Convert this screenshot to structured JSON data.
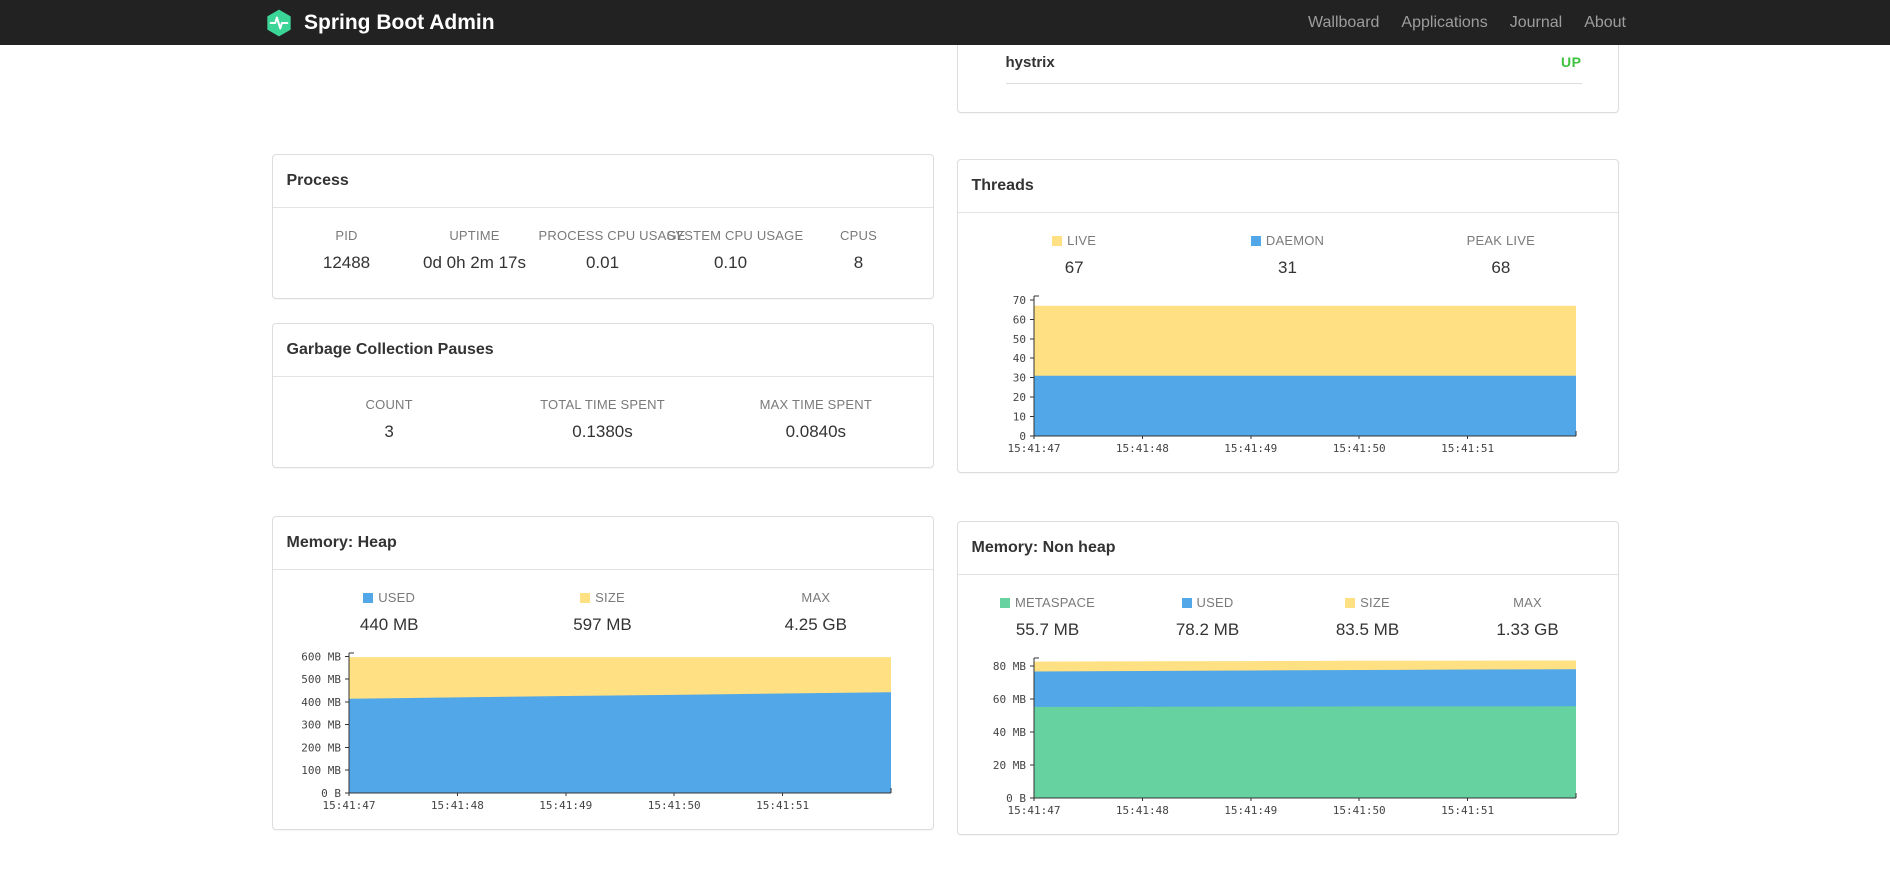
{
  "navbar": {
    "brand_title": "Spring Boot Admin",
    "links": [
      {
        "label": "Wallboard"
      },
      {
        "label": "Applications"
      },
      {
        "label": "Journal"
      },
      {
        "label": "About"
      }
    ]
  },
  "colors": {
    "navbar_bg": "#222222",
    "brand_green": "#3cd598",
    "status_up": "#3fc23f",
    "chart_yellow": "#ffe082",
    "chart_blue": "#51a7e8",
    "chart_green": "#66d2a0"
  },
  "application_status": {
    "name": "hystrix",
    "status": "UP",
    "status_color": "#3fc23f"
  },
  "panels": {
    "process": {
      "title": "Process",
      "stats": [
        {
          "label": "PID",
          "value": "12488"
        },
        {
          "label": "UPTIME",
          "value": "0d 0h 2m 17s"
        },
        {
          "label": "PROCESS CPU USAGE",
          "value": "0.01"
        },
        {
          "label": "SYSTEM CPU USAGE",
          "value": "0.10"
        },
        {
          "label": "CPUS",
          "value": "8"
        }
      ]
    },
    "gc": {
      "title": "Garbage Collection Pauses",
      "stats": [
        {
          "label": "COUNT",
          "value": "3"
        },
        {
          "label": "TOTAL TIME SPENT",
          "value": "0.1380s"
        },
        {
          "label": "MAX TIME SPENT",
          "value": "0.0840s"
        }
      ]
    },
    "threads": {
      "title": "Threads",
      "stats": [
        {
          "label": "LIVE",
          "value": "67",
          "swatch": "#ffe082"
        },
        {
          "label": "DAEMON",
          "value": "31",
          "swatch": "#51a7e8"
        },
        {
          "label": "PEAK LIVE",
          "value": "68"
        }
      ]
    },
    "heap": {
      "title": "Memory: Heap",
      "stats": [
        {
          "label": "USED",
          "value": "440 MB",
          "swatch": "#51a7e8"
        },
        {
          "label": "SIZE",
          "value": "597 MB",
          "swatch": "#ffe082"
        },
        {
          "label": "MAX",
          "value": "4.25 GB"
        }
      ]
    },
    "nonheap": {
      "title": "Memory: Non heap",
      "stats": [
        {
          "label": "METASPACE",
          "value": "55.7 MB",
          "swatch": "#66d2a0"
        },
        {
          "label": "USED",
          "value": "78.2 MB",
          "swatch": "#51a7e8"
        },
        {
          "label": "SIZE",
          "value": "83.5 MB",
          "swatch": "#ffe082"
        },
        {
          "label": "MAX",
          "value": "1.33 GB"
        }
      ]
    }
  },
  "chart_data": [
    {
      "id": "threads",
      "type": "area",
      "title": "Threads",
      "x_labels": [
        "15:41:47",
        "15:41:48",
        "15:41:49",
        "15:41:50",
        "15:41:51"
      ],
      "y_axis": {
        "tick_values": [
          0,
          10,
          20,
          30,
          40,
          50,
          60,
          70
        ],
        "tick_labels": [
          "0",
          "10",
          "20",
          "30",
          "40",
          "50",
          "60",
          "70"
        ],
        "max": 72
      },
      "series": [
        {
          "name": "LIVE",
          "color": "#ffe082",
          "values": [
            67,
            67,
            67,
            67,
            67,
            67
          ]
        },
        {
          "name": "DAEMON",
          "color": "#51a7e8",
          "values": [
            31,
            31,
            31,
            31,
            31,
            31
          ]
        }
      ]
    },
    {
      "id": "heap",
      "type": "area",
      "title": "Memory: Heap",
      "x_labels": [
        "15:41:47",
        "15:41:48",
        "15:41:49",
        "15:41:50",
        "15:41:51"
      ],
      "y_axis": {
        "tick_values": [
          0,
          100,
          200,
          300,
          400,
          500,
          600
        ],
        "tick_labels": [
          "0 B",
          "100 MB",
          "200 MB",
          "300 MB",
          "400 MB",
          "500 MB",
          "600 MB"
        ],
        "max": 615
      },
      "series": [
        {
          "name": "SIZE",
          "color": "#ffe082",
          "values": [
            597,
            597,
            597,
            597,
            597,
            597
          ]
        },
        {
          "name": "USED",
          "color": "#51a7e8",
          "values": [
            414,
            420,
            426,
            431,
            437,
            443
          ]
        }
      ]
    },
    {
      "id": "nonheap",
      "type": "area",
      "title": "Memory: Non heap",
      "x_labels": [
        "15:41:47",
        "15:41:48",
        "15:41:49",
        "15:41:50",
        "15:41:51"
      ],
      "y_axis": {
        "tick_values": [
          0,
          20,
          40,
          60,
          80
        ],
        "tick_labels": [
          "0 B",
          "20 MB",
          "40 MB",
          "60 MB",
          "80 MB"
        ],
        "max": 85
      },
      "series": [
        {
          "name": "SIZE",
          "color": "#ffe082",
          "values": [
            82.8,
            83.0,
            83.1,
            83.3,
            83.4,
            83.5
          ]
        },
        {
          "name": "USED",
          "color": "#51a7e8",
          "values": [
            76.8,
            77.1,
            77.4,
            77.7,
            78.0,
            78.2
          ]
        },
        {
          "name": "METASPACE",
          "color": "#66d2a0",
          "values": [
            55.3,
            55.4,
            55.5,
            55.6,
            55.6,
            55.7
          ]
        }
      ]
    }
  ]
}
